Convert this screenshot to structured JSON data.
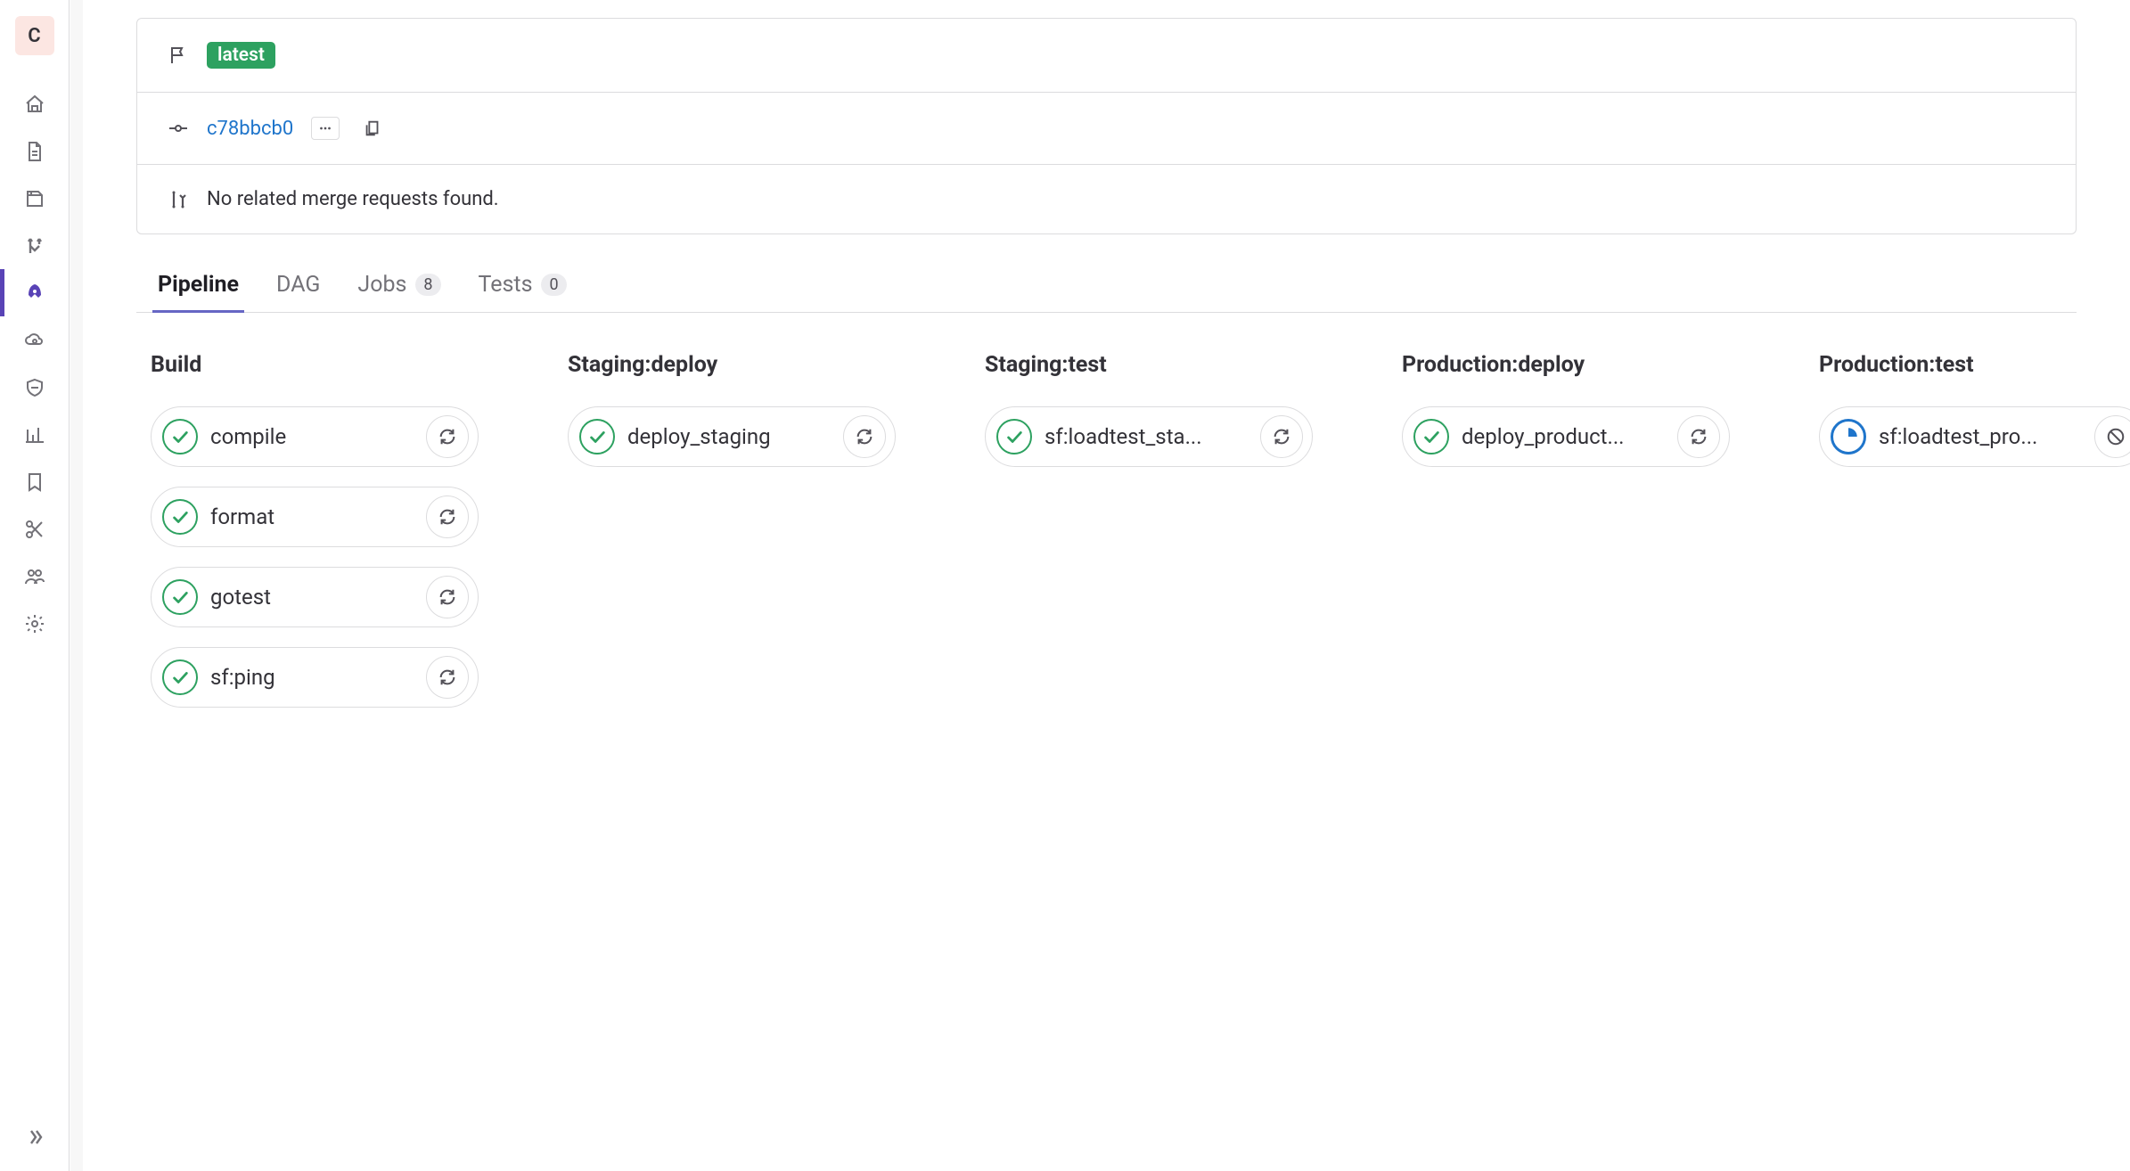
{
  "sidebar_logo": "C",
  "header": {
    "badge": "latest",
    "commit_sha": "c78bbcb0",
    "no_mr_text": "No related merge requests found."
  },
  "tabs": [
    {
      "label": "Pipeline",
      "count": null,
      "active": true
    },
    {
      "label": "DAG",
      "count": null,
      "active": false
    },
    {
      "label": "Jobs",
      "count": "8",
      "active": false
    },
    {
      "label": "Tests",
      "count": "0",
      "active": false
    }
  ],
  "stages": [
    {
      "title": "Build",
      "jobs": [
        {
          "name": "compile",
          "status": "passed",
          "action": "retry"
        },
        {
          "name": "format",
          "status": "passed",
          "action": "retry"
        },
        {
          "name": "gotest",
          "status": "passed",
          "action": "retry"
        },
        {
          "name": "sf:ping",
          "status": "passed",
          "action": "retry"
        }
      ]
    },
    {
      "title": "Staging:deploy",
      "jobs": [
        {
          "name": "deploy_staging",
          "status": "passed",
          "action": "retry"
        }
      ]
    },
    {
      "title": "Staging:test",
      "jobs": [
        {
          "name": "sf:loadtest_sta...",
          "status": "passed",
          "action": "retry"
        }
      ]
    },
    {
      "title": "Production:deploy",
      "jobs": [
        {
          "name": "deploy_product...",
          "status": "passed",
          "action": "retry"
        }
      ]
    },
    {
      "title": "Production:test",
      "jobs": [
        {
          "name": "sf:loadtest_pro...",
          "status": "running",
          "action": "cancel"
        }
      ]
    }
  ]
}
